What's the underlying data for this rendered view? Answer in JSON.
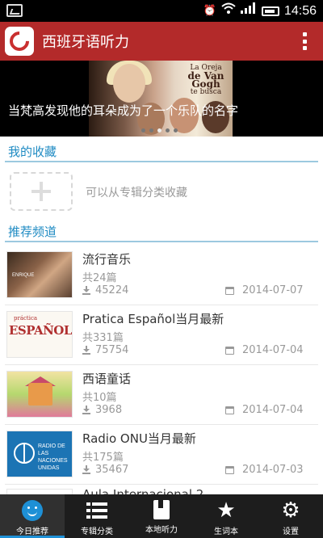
{
  "status_bar": {
    "time": "14:56",
    "icons": [
      "image-icon",
      "alarm-icon",
      "wifi-icon",
      "signal-icon",
      "battery-icon"
    ]
  },
  "app_bar": {
    "title": "西班牙语听力",
    "menu_icon": "overflow-menu-icon"
  },
  "banner": {
    "caption": "当梵高发现他的耳朵成为了一个乐队的名字",
    "image_text_line1": "La Oreja",
    "image_text_line2": "de Van Gogh",
    "image_text_line3": "te busca",
    "page_count": 5,
    "active_page": 3
  },
  "favorites": {
    "header": "我的收藏",
    "add_hint": "可以从专辑分类收藏"
  },
  "recommended": {
    "header": "推荐频道",
    "channels": [
      {
        "title": "流行音乐",
        "count": "共24篇",
        "downloads": "45224",
        "date": "2014-07-07",
        "thumb_text": "ENRIQUE"
      },
      {
        "title": "Pratica Español当月最新",
        "count": "共331篇",
        "downloads": "75754",
        "date": "2014-07-04",
        "thumb_text_top": "práctica",
        "thumb_text": "ESPAÑOL"
      },
      {
        "title": "西语童话",
        "count": "共10篇",
        "downloads": "3968",
        "date": "2014-07-04"
      },
      {
        "title": "Radio ONU当月最新",
        "count": "共175篇",
        "downloads": "35467",
        "date": "2014-07-03",
        "thumb_text": "RADIO DE LAS NACIONES UNIDAS"
      },
      {
        "title": "Aula Internacional 2"
      }
    ]
  },
  "bottom_nav": {
    "items": [
      {
        "label": "今日推荐",
        "icon": "smile-icon",
        "active": true
      },
      {
        "label": "专辑分类",
        "icon": "list-icon",
        "active": false
      },
      {
        "label": "本地听力",
        "icon": "book-icon",
        "active": false
      },
      {
        "label": "生词本",
        "icon": "star-icon",
        "active": false
      },
      {
        "label": "设置",
        "icon": "gear-icon",
        "active": false
      }
    ]
  },
  "colors": {
    "app_bar": "#b32a2a",
    "section_header": "#1f8bc3",
    "nav_accent": "#1e90d6"
  }
}
